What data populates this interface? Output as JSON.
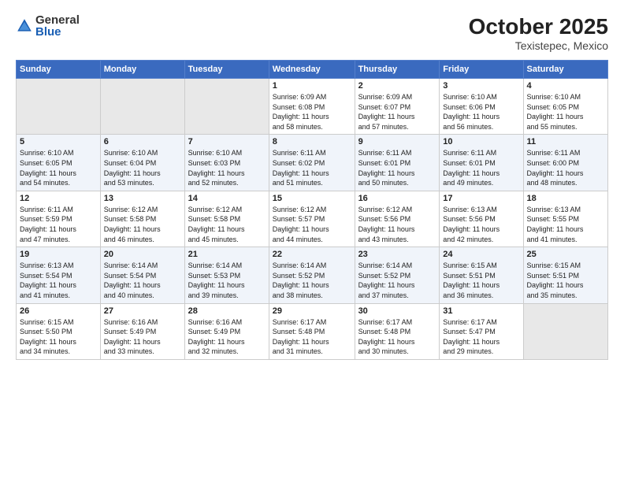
{
  "header": {
    "logo_general": "General",
    "logo_blue": "Blue",
    "month": "October 2025",
    "location": "Texistepec, Mexico"
  },
  "weekdays": [
    "Sunday",
    "Monday",
    "Tuesday",
    "Wednesday",
    "Thursday",
    "Friday",
    "Saturday"
  ],
  "weeks": [
    [
      {
        "day": "",
        "info": ""
      },
      {
        "day": "",
        "info": ""
      },
      {
        "day": "",
        "info": ""
      },
      {
        "day": "1",
        "info": "Sunrise: 6:09 AM\nSunset: 6:08 PM\nDaylight: 11 hours\nand 58 minutes."
      },
      {
        "day": "2",
        "info": "Sunrise: 6:09 AM\nSunset: 6:07 PM\nDaylight: 11 hours\nand 57 minutes."
      },
      {
        "day": "3",
        "info": "Sunrise: 6:10 AM\nSunset: 6:06 PM\nDaylight: 11 hours\nand 56 minutes."
      },
      {
        "day": "4",
        "info": "Sunrise: 6:10 AM\nSunset: 6:05 PM\nDaylight: 11 hours\nand 55 minutes."
      }
    ],
    [
      {
        "day": "5",
        "info": "Sunrise: 6:10 AM\nSunset: 6:05 PM\nDaylight: 11 hours\nand 54 minutes."
      },
      {
        "day": "6",
        "info": "Sunrise: 6:10 AM\nSunset: 6:04 PM\nDaylight: 11 hours\nand 53 minutes."
      },
      {
        "day": "7",
        "info": "Sunrise: 6:10 AM\nSunset: 6:03 PM\nDaylight: 11 hours\nand 52 minutes."
      },
      {
        "day": "8",
        "info": "Sunrise: 6:11 AM\nSunset: 6:02 PM\nDaylight: 11 hours\nand 51 minutes."
      },
      {
        "day": "9",
        "info": "Sunrise: 6:11 AM\nSunset: 6:01 PM\nDaylight: 11 hours\nand 50 minutes."
      },
      {
        "day": "10",
        "info": "Sunrise: 6:11 AM\nSunset: 6:01 PM\nDaylight: 11 hours\nand 49 minutes."
      },
      {
        "day": "11",
        "info": "Sunrise: 6:11 AM\nSunset: 6:00 PM\nDaylight: 11 hours\nand 48 minutes."
      }
    ],
    [
      {
        "day": "12",
        "info": "Sunrise: 6:11 AM\nSunset: 5:59 PM\nDaylight: 11 hours\nand 47 minutes."
      },
      {
        "day": "13",
        "info": "Sunrise: 6:12 AM\nSunset: 5:58 PM\nDaylight: 11 hours\nand 46 minutes."
      },
      {
        "day": "14",
        "info": "Sunrise: 6:12 AM\nSunset: 5:58 PM\nDaylight: 11 hours\nand 45 minutes."
      },
      {
        "day": "15",
        "info": "Sunrise: 6:12 AM\nSunset: 5:57 PM\nDaylight: 11 hours\nand 44 minutes."
      },
      {
        "day": "16",
        "info": "Sunrise: 6:12 AM\nSunset: 5:56 PM\nDaylight: 11 hours\nand 43 minutes."
      },
      {
        "day": "17",
        "info": "Sunrise: 6:13 AM\nSunset: 5:56 PM\nDaylight: 11 hours\nand 42 minutes."
      },
      {
        "day": "18",
        "info": "Sunrise: 6:13 AM\nSunset: 5:55 PM\nDaylight: 11 hours\nand 41 minutes."
      }
    ],
    [
      {
        "day": "19",
        "info": "Sunrise: 6:13 AM\nSunset: 5:54 PM\nDaylight: 11 hours\nand 41 minutes."
      },
      {
        "day": "20",
        "info": "Sunrise: 6:14 AM\nSunset: 5:54 PM\nDaylight: 11 hours\nand 40 minutes."
      },
      {
        "day": "21",
        "info": "Sunrise: 6:14 AM\nSunset: 5:53 PM\nDaylight: 11 hours\nand 39 minutes."
      },
      {
        "day": "22",
        "info": "Sunrise: 6:14 AM\nSunset: 5:52 PM\nDaylight: 11 hours\nand 38 minutes."
      },
      {
        "day": "23",
        "info": "Sunrise: 6:14 AM\nSunset: 5:52 PM\nDaylight: 11 hours\nand 37 minutes."
      },
      {
        "day": "24",
        "info": "Sunrise: 6:15 AM\nSunset: 5:51 PM\nDaylight: 11 hours\nand 36 minutes."
      },
      {
        "day": "25",
        "info": "Sunrise: 6:15 AM\nSunset: 5:51 PM\nDaylight: 11 hours\nand 35 minutes."
      }
    ],
    [
      {
        "day": "26",
        "info": "Sunrise: 6:15 AM\nSunset: 5:50 PM\nDaylight: 11 hours\nand 34 minutes."
      },
      {
        "day": "27",
        "info": "Sunrise: 6:16 AM\nSunset: 5:49 PM\nDaylight: 11 hours\nand 33 minutes."
      },
      {
        "day": "28",
        "info": "Sunrise: 6:16 AM\nSunset: 5:49 PM\nDaylight: 11 hours\nand 32 minutes."
      },
      {
        "day": "29",
        "info": "Sunrise: 6:17 AM\nSunset: 5:48 PM\nDaylight: 11 hours\nand 31 minutes."
      },
      {
        "day": "30",
        "info": "Sunrise: 6:17 AM\nSunset: 5:48 PM\nDaylight: 11 hours\nand 30 minutes."
      },
      {
        "day": "31",
        "info": "Sunrise: 6:17 AM\nSunset: 5:47 PM\nDaylight: 11 hours\nand 29 minutes."
      },
      {
        "day": "",
        "info": ""
      }
    ]
  ]
}
